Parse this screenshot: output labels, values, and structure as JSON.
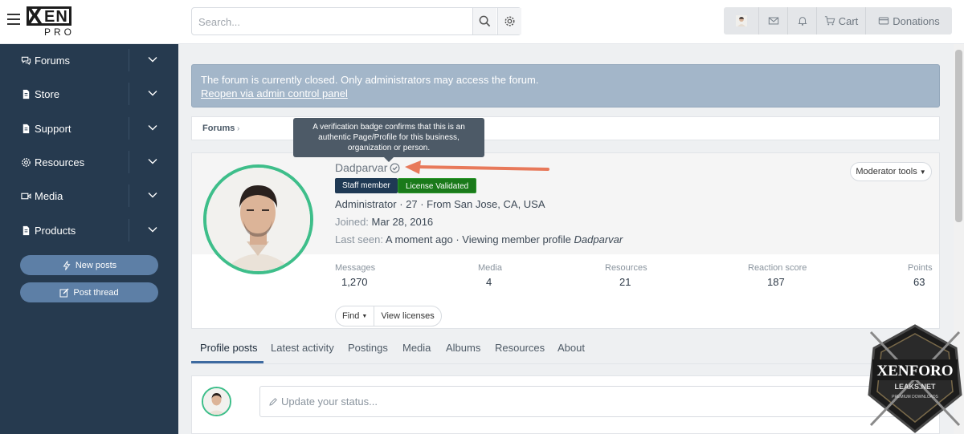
{
  "header": {
    "logo_text": "XEN PRO",
    "search_placeholder": "Search...",
    "nav": [
      {
        "icon": "avatar-thumb",
        "label": ""
      },
      {
        "icon": "envelope-icon",
        "label": ""
      },
      {
        "icon": "bell-icon",
        "label": ""
      },
      {
        "icon": "cart-icon",
        "label": "Cart"
      },
      {
        "icon": "donations-icon",
        "label": "Donations"
      }
    ]
  },
  "sidebar": {
    "items": [
      {
        "label": "Forums",
        "icon": "comments-icon"
      },
      {
        "label": "Store",
        "icon": "file-icon"
      },
      {
        "label": "Support",
        "icon": "file-icon"
      },
      {
        "label": "Resources",
        "icon": "gear-icon"
      },
      {
        "label": "Media",
        "icon": "video-icon"
      },
      {
        "label": "Products",
        "icon": "file-icon"
      }
    ],
    "buttons": [
      {
        "label": "New posts",
        "icon": "bolt-icon"
      },
      {
        "label": "Post thread",
        "icon": "edit-icon"
      }
    ]
  },
  "notice": {
    "text": "The forum is currently closed. Only administrators may access the forum.",
    "link": "Reopen via admin control panel"
  },
  "breadcrumb": {
    "root": "Forums"
  },
  "tooltip": {
    "text": "A verification badge confirms that this is an authentic Page/Profile for this business, organization or person."
  },
  "profile": {
    "username": "Dadparvar",
    "badges": [
      "Staff member",
      "License Validated"
    ],
    "line1": "Administrator · 27 · From San Jose, CA, USA",
    "joined_label": "Joined:",
    "joined_value": "Mar 28, 2016",
    "lastseen_label": "Last seen:",
    "lastseen_value": "A moment ago · Viewing member profile",
    "lastseen_name": "Dadparvar",
    "moderator_tools": "Moderator tools",
    "stats": [
      {
        "label": "Messages",
        "value": "1,270"
      },
      {
        "label": "Media",
        "value": "4"
      },
      {
        "label": "Resources",
        "value": "21"
      },
      {
        "label": "Reaction score",
        "value": "187"
      },
      {
        "label": "Points",
        "value": "63"
      }
    ],
    "buttons": {
      "find": "Find",
      "licenses": "View licenses"
    }
  },
  "tabs": [
    {
      "label": "Profile posts",
      "active": true
    },
    {
      "label": "Latest activity",
      "active": false
    },
    {
      "label": "Postings",
      "active": false
    },
    {
      "label": "Media",
      "active": false
    },
    {
      "label": "Albums",
      "active": false
    },
    {
      "label": "Resources",
      "active": false
    },
    {
      "label": "About",
      "active": false
    }
  ],
  "status": {
    "placeholder": "Update your status..."
  },
  "watermark": {
    "line1": "XENFORO",
    "line2": "LEAKS.NET",
    "line3": "PREMIUM DOWNLOADS"
  },
  "colors": {
    "sidebar_bg": "#263a4f",
    "notice_bg": "#a3b6c9",
    "avatar_ring": "#3ebe8a",
    "staff_badge": "#1f3954",
    "license_badge": "#1a7a1a",
    "annotation_arrow": "#e8795a"
  }
}
